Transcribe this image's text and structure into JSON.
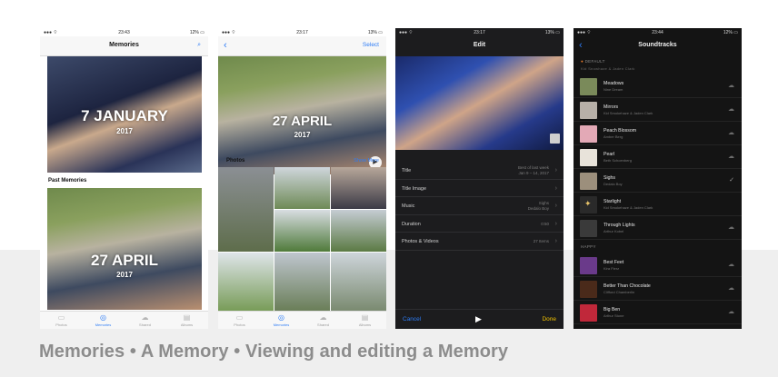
{
  "caption": "Memories • A Memory • Viewing and editing a Memory",
  "screens": {
    "memories": {
      "status": {
        "left": "●●● ⌔",
        "time": "23:43",
        "right": "12% ▭"
      },
      "title": "Memories",
      "search_icon": "search-icon",
      "card1": {
        "date": "7 JANUARY",
        "year": "2017"
      },
      "past_label": "Past Memories",
      "card2": {
        "date": "27 APRIL",
        "year": "2017"
      },
      "tabs": [
        {
          "label": "Photos",
          "icon": "photos-tab-icon",
          "glyph": "▭"
        },
        {
          "label": "Memories",
          "icon": "memories-tab-icon",
          "glyph": "◎"
        },
        {
          "label": "Shared",
          "icon": "shared-tab-icon",
          "glyph": "☁"
        },
        {
          "label": "Albums",
          "icon": "albums-tab-icon",
          "glyph": "▤"
        }
      ]
    },
    "memory": {
      "status": {
        "left": "●●● ⌔",
        "time": "23:17",
        "right": "13% ▭"
      },
      "back": "‹",
      "select": "Select",
      "hero": {
        "date": "27 APRIL",
        "year": "2017"
      },
      "photos_label": "Photos",
      "show_more": "Show More",
      "tabs": [
        {
          "label": "Photos",
          "icon": "photos-tab-icon",
          "glyph": "▭"
        },
        {
          "label": "Memories",
          "icon": "memories-tab-icon",
          "glyph": "◎"
        },
        {
          "label": "Shared",
          "icon": "shared-tab-icon",
          "glyph": "☁"
        },
        {
          "label": "Albums",
          "icon": "albums-tab-icon",
          "glyph": "▤"
        }
      ]
    },
    "edit": {
      "status": {
        "left": "●●● ⌔",
        "time": "23:17",
        "right": "13% ▭"
      },
      "title": "Edit",
      "rows": [
        {
          "label": "Title",
          "value_line1": "Best of last week",
          "value_line2": "Jan 9 – 14, 2017"
        },
        {
          "label": "Title Image",
          "value_line1": "",
          "value_line2": ""
        },
        {
          "label": "Music",
          "value_line1": "Sighs",
          "value_line2": "Dedalo Boy"
        },
        {
          "label": "Duration",
          "value_line1": "0:50",
          "value_line2": ""
        },
        {
          "label": "Photos & Videos",
          "value_line1": "27 Items",
          "value_line2": ""
        }
      ],
      "cancel": "Cancel",
      "done": "Done"
    },
    "soundtracks": {
      "status": {
        "left": "●●● ⌔",
        "time": "23:44",
        "right": "12% ▭"
      },
      "title": "Soundtracks",
      "default_label": "DEFAULT",
      "default_sub": "Kid Snowhaze & Jaden Clark",
      "tracks": [
        {
          "name": "Meadows",
          "artist": "Nine Dream",
          "color": "#7a8a5a"
        },
        {
          "name": "Mirrors",
          "artist": "Kid Smokehaze & Jaden Clark",
          "color": "#b7b0a8"
        },
        {
          "name": "Peach Blossom",
          "artist": "Amber Berg",
          "color": "#e3a9b6"
        },
        {
          "name": "Pearl",
          "artist": "Beth Schoenberg",
          "color": "#e8e3da"
        },
        {
          "name": "Sighs",
          "artist": "Dedalo Boy",
          "color": "#9c8f7c"
        },
        {
          "name": "Starlight",
          "artist": "Kid Smokehaze & Jaden Clark",
          "color": "#2a2a2a"
        },
        {
          "name": "Through Lights",
          "artist": "Arthur Kobel",
          "color": "#3a3a3a"
        }
      ],
      "happy_label": "HAPPY",
      "happy_tracks": [
        {
          "name": "Best Feet",
          "artist": "Kira Fierz",
          "color": "#6a3a8a"
        },
        {
          "name": "Better Than Chocolate",
          "artist": "Clifford Chamberlin",
          "color": "#4a2a1a"
        },
        {
          "name": "Big Ben",
          "artist": "Arthur Stone",
          "color": "#c0283a"
        }
      ]
    }
  }
}
